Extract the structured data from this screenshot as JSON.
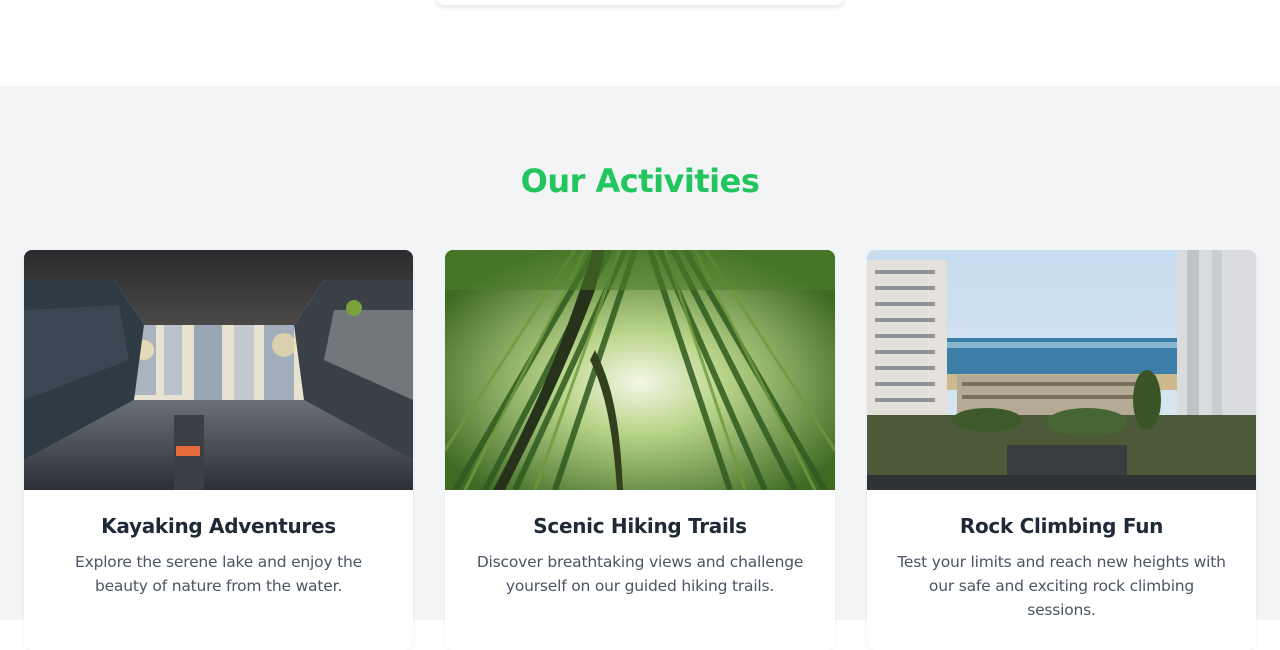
{
  "section": {
    "title": "Our Activities",
    "accent_color": "#22c55e",
    "background_color": "#f2f4f6"
  },
  "activities": [
    {
      "title": "Kayaking Adventures",
      "description": "Explore the serene lake and enjoy the beauty of nature from the water.",
      "image": "tunnel-view-photo"
    },
    {
      "title": "Scenic Hiking Trails",
      "description": "Discover breathtaking views and challenge yourself on our guided hiking trails.",
      "image": "bamboo-forest-photo"
    },
    {
      "title": "Rock Climbing Fun",
      "description": "Test your limits and reach new heights with our safe and exciting rock climbing sessions.",
      "image": "seaside-buildings-photo"
    }
  ]
}
